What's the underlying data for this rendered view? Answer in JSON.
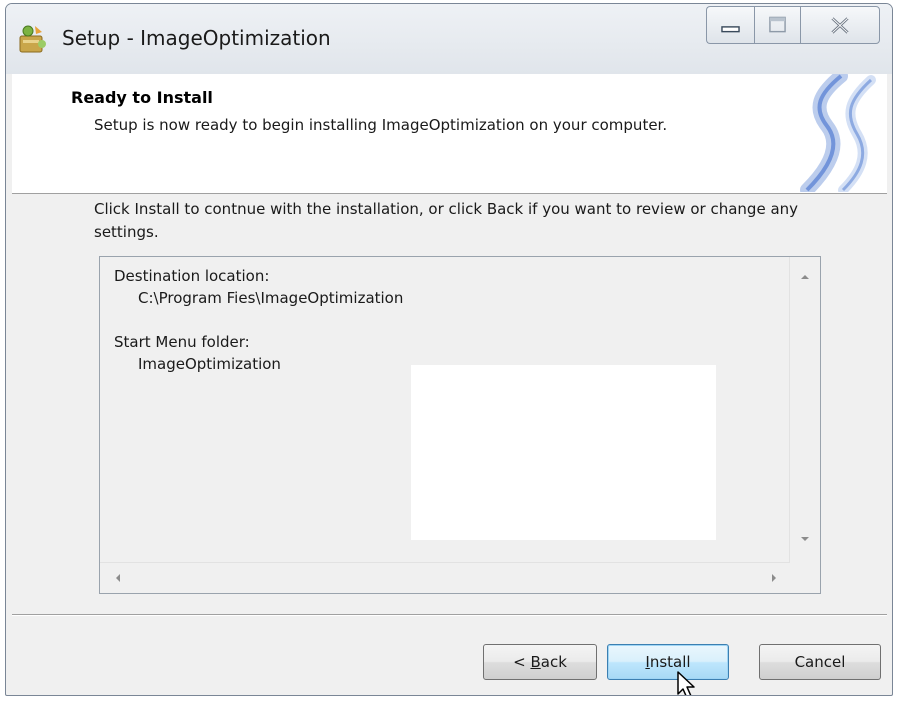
{
  "window": {
    "title": "Setup - ImageOptimization"
  },
  "header": {
    "title": "Ready to Install",
    "subtitle": "Setup is now ready to begin installing ImageOptimization on your computer."
  },
  "body": {
    "instruction": "Click Install to contnue with the installation, or click Back if you want to review or change any settings."
  },
  "memo": {
    "destination_label": "Destination location:",
    "destination_value": "C:\\Program Fies\\ImageOptimization",
    "start_menu_label": "Start Menu folder:",
    "start_menu_value": "ImageOptimization"
  },
  "buttons": {
    "back_prefix": "< ",
    "back_mnemonic": "B",
    "back_rest": "ack",
    "install_mnemonic": "I",
    "install_rest": "nstall",
    "cancel": "Cancel"
  },
  "colors": {
    "accent_default_button": "#3c7fb1",
    "window_background": "#f0f0f0"
  },
  "icons": [
    "setup-app-icon",
    "minimize-icon",
    "maximize-icon",
    "close-icon",
    "wizard-swirl-graphic",
    "scroll-up-arrow-icon",
    "scroll-down-arrow-icon",
    "scroll-left-arrow-icon",
    "scroll-right-arrow-icon",
    "mouse-pointer-icon"
  ]
}
